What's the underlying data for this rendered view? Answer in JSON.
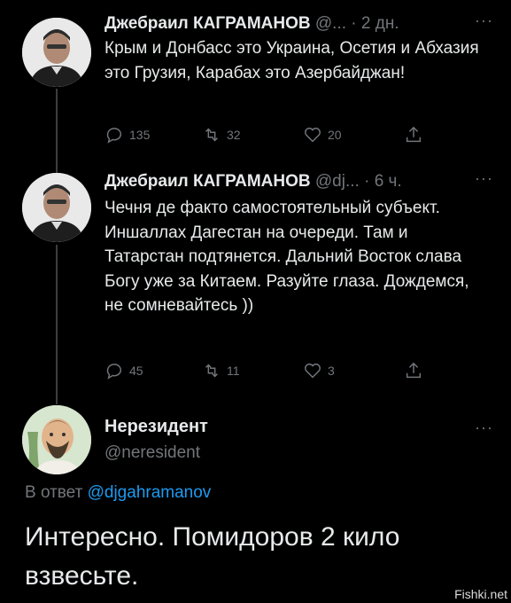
{
  "tweet1": {
    "name": "Джебраил КАГРАМАНОВ",
    "handle": "@...",
    "separator": "·",
    "time": "2 дн.",
    "text": "Крым и Донбасс это Украина, Осетия и Абхазия это Грузия, Карабах это Азербайджан!",
    "replies": "135",
    "retweets": "32",
    "likes": "20"
  },
  "tweet2": {
    "name": "Джебраил КАГРАМАНОВ",
    "handle": "@dj...",
    "separator": "·",
    "time": "6 ч.",
    "text": "Чечня де факто самостоятельный субъект. Иншаллах Дагестан на очереди. Там и Татарстан подтянется. Дальний Восток слава Богу уже за Китаем. Разуйте глаза. Дождемся, не сомневайтесь ))",
    "replies": "45",
    "retweets": "11",
    "likes": "3"
  },
  "reply": {
    "name": "Нерезидент",
    "handle": "@neresident",
    "in_reply_prefix": "В ответ",
    "in_reply_mention": "@djgahramanov",
    "text": "Интересно. Помидоров 2 кило взвесьте."
  },
  "more_label": "···",
  "watermark": "Fishki.net",
  "icons": {
    "reply": "comment-icon",
    "retweet": "retweet-icon",
    "like": "heart-icon",
    "share": "share-icon"
  },
  "colors": {
    "background": "#000000",
    "text": "#e7e9ea",
    "muted": "#71767b",
    "link": "#1d9bf0"
  }
}
